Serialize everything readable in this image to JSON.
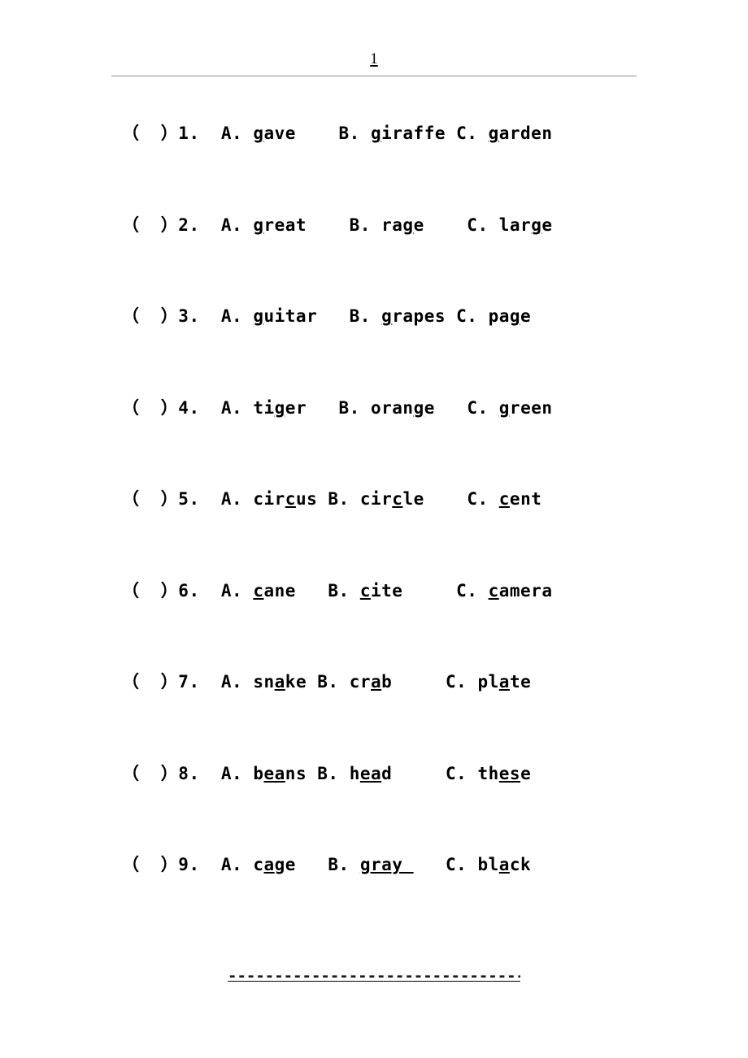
{
  "header": {
    "page_number": "1"
  },
  "quiz": {
    "bracket": "（  ）",
    "items": [
      {
        "number": "1.",
        "options": [
          {
            "label": "A.",
            "pre": "",
            "mark": "g",
            "post": "ave",
            "gap_after": "    "
          },
          {
            "label": "B.",
            "pre": "",
            "mark": "g",
            "post": "iraffe",
            "gap_after": " "
          },
          {
            "label": "C.",
            "pre": "",
            "mark": "g",
            "post": "arden",
            "gap_after": ""
          }
        ]
      },
      {
        "number": "2.",
        "options": [
          {
            "label": "A.",
            "pre": "",
            "mark": "g",
            "post": "reat",
            "gap_after": "    "
          },
          {
            "label": "B.",
            "pre": "ra",
            "mark": "g",
            "post": "e",
            "gap_after": "    "
          },
          {
            "label": "C.",
            "pre": "lar",
            "mark": "g",
            "post": "e",
            "gap_after": ""
          }
        ]
      },
      {
        "number": "3.",
        "options": [
          {
            "label": "A.",
            "pre": "",
            "mark": "g",
            "post": "uitar",
            "gap_after": "   "
          },
          {
            "label": "B.",
            "pre": "",
            "mark": "g",
            "post": "rapes",
            "gap_after": " "
          },
          {
            "label": "C.",
            "pre": "pa",
            "mark": "g",
            "post": "e",
            "gap_after": ""
          }
        ]
      },
      {
        "number": "4.",
        "options": [
          {
            "label": "A.",
            "pre": "ti",
            "mark": "g",
            "post": "er",
            "gap_after": "   "
          },
          {
            "label": "B.",
            "pre": "oran",
            "mark": "g",
            "post": "e",
            "gap_after": "   "
          },
          {
            "label": "C.",
            "pre": "",
            "mark": "g",
            "post": "reen",
            "gap_after": ""
          }
        ]
      },
      {
        "number": "5.",
        "options": [
          {
            "label": "A.",
            "pre": "cir",
            "mark": "c",
            "post": "us",
            "gap_after": " "
          },
          {
            "label": "B.",
            "pre": "cir",
            "mark": "c",
            "post": "le",
            "gap_after": "    "
          },
          {
            "label": "C.",
            "pre": "",
            "mark": "c",
            "post": "ent",
            "gap_after": ""
          }
        ]
      },
      {
        "number": "6.",
        "options": [
          {
            "label": "A.",
            "pre": "",
            "mark": "c",
            "post": "ane",
            "gap_after": "   "
          },
          {
            "label": "B.",
            "pre": "",
            "mark": "c",
            "post": "ite",
            "gap_after": "     "
          },
          {
            "label": "C.",
            "pre": "",
            "mark": "c",
            "post": "amera",
            "gap_after": ""
          }
        ]
      },
      {
        "number": "7.",
        "options": [
          {
            "label": "A.",
            "pre": "sn",
            "mark": "a",
            "post": "ke",
            "gap_after": " "
          },
          {
            "label": "B.",
            "pre": "cr",
            "mark": "a",
            "post": "b",
            "gap_after": "     "
          },
          {
            "label": "C.",
            "pre": "pl",
            "mark": "a",
            "post": "te",
            "gap_after": ""
          }
        ]
      },
      {
        "number": "8.",
        "options": [
          {
            "label": "A.",
            "pre": "b",
            "mark": "ea",
            "post": "ns",
            "gap_after": " "
          },
          {
            "label": "B.",
            "pre": "h",
            "mark": "ea",
            "post": "d",
            "gap_after": "     "
          },
          {
            "label": "C.",
            "pre": "th",
            "mark": "es",
            "post": "e",
            "gap_after": ""
          }
        ]
      },
      {
        "number": "9.",
        "options": [
          {
            "label": "A.",
            "pre": "c",
            "mark": "a",
            "post": "ge",
            "gap_after": "   "
          },
          {
            "label": "B.",
            "pre": "",
            "mark": "gray ",
            "post": "",
            "gap_after": "   "
          },
          {
            "label": "C.",
            "pre": "bl",
            "mark": "a",
            "post": "ck",
            "gap_after": ""
          }
        ]
      }
    ]
  },
  "footer": {
    "dashes": "---------------------------------------------------"
  }
}
